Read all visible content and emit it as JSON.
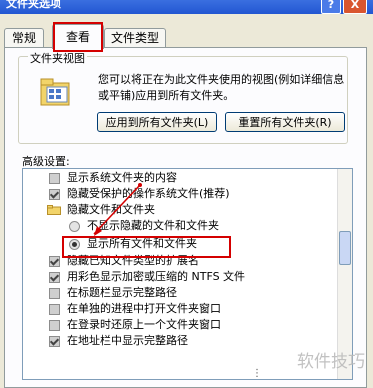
{
  "window": {
    "title": "文件夹选项",
    "help_label": "?",
    "close_label": "X"
  },
  "tabs": [
    {
      "label": "常规"
    },
    {
      "label": "查看"
    },
    {
      "label": "文件类型"
    }
  ],
  "folder_views": {
    "legend": "文件夹视图",
    "description": "您可以将正在为此文件夹使用的视图(例如详细信息或平铺)应用到所有文件夹。",
    "apply_button": "应用到所有文件夹(L)",
    "reset_button": "重置所有文件夹(R)"
  },
  "advanced": {
    "label": "高级设置:",
    "items": [
      {
        "text": "显示系统文件夹的内容",
        "type": "checkbox",
        "checked": false
      },
      {
        "text": "隐藏受保护的操作系统文件(推荐)",
        "type": "checkbox",
        "checked": true
      },
      {
        "text": "隐藏文件和文件夹",
        "type": "folder"
      },
      {
        "text": "不显示隐藏的文件和文件夹",
        "type": "radio",
        "selected": false
      },
      {
        "text": "显示所有文件和文件夹",
        "type": "radio",
        "selected": true
      },
      {
        "text": "隐藏已知文件类型的扩展名",
        "type": "checkbox",
        "checked": true
      },
      {
        "text": "用彩色显示加密或压缩的 NTFS 文件",
        "type": "checkbox",
        "checked": true
      },
      {
        "text": "在标题栏显示完整路径",
        "type": "checkbox",
        "checked": false
      },
      {
        "text": "在单独的进程中打开文件夹窗口",
        "type": "checkbox",
        "checked": false
      },
      {
        "text": "在登录时还原上一个文件夹窗口",
        "type": "checkbox",
        "checked": false
      },
      {
        "text": "在地址栏中显示完整路径",
        "type": "checkbox",
        "checked": true
      }
    ]
  },
  "watermark": "软件技巧"
}
